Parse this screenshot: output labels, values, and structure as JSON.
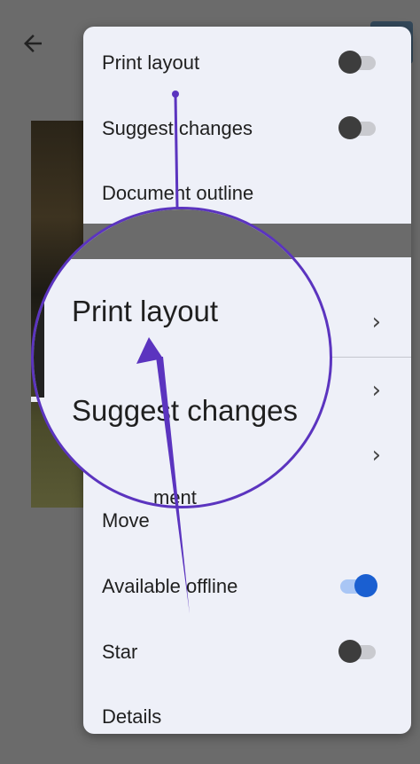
{
  "menu": {
    "items": [
      {
        "label": "Print layout",
        "control": "toggle",
        "on": false
      },
      {
        "label": "Suggest changes",
        "control": "toggle",
        "on": false
      },
      {
        "label": "Document outline",
        "control": "none"
      },
      {
        "label": "Move",
        "control": "none"
      },
      {
        "label": "Available offline",
        "control": "toggle",
        "on": true
      },
      {
        "label": "Star",
        "control": "toggle",
        "on": false
      },
      {
        "label": "Details",
        "control": "none"
      }
    ]
  },
  "magnifier": {
    "line1": "Print layout",
    "line2": "Suggest changes",
    "ghost": "ment"
  },
  "icons": {
    "back": "arrow-back-icon",
    "chevron": "chevron-right-icon"
  },
  "colors": {
    "annotation": "#5b34bf",
    "toggle_on": "#1a5fd1",
    "menu_bg": "#eef0f8",
    "overlay": "#6b6b6b"
  }
}
